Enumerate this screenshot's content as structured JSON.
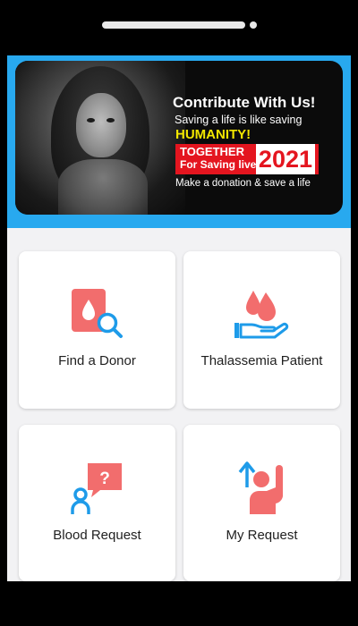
{
  "banner": {
    "title": "Contribute With Us!",
    "subtitle": "Saving a life is like saving",
    "highlight": "HUMANITY!",
    "badge_line1": "TOGETHER",
    "badge_line2": "For Saving lives",
    "badge_year": "2021",
    "tagline": "Make a donation & save a life"
  },
  "cards": [
    {
      "label": "Find a Donor",
      "icon": "blood-bag-search-icon"
    },
    {
      "label": "Thalassemia Patient",
      "icon": "hand-blood-drop-icon"
    },
    {
      "label": "Blood Request",
      "icon": "person-question-icon"
    },
    {
      "label": "My Request",
      "icon": "person-raise-hand-icon"
    }
  ],
  "colors": {
    "accent_red": "#f26d6d",
    "accent_blue": "#1e9be9",
    "banner_bg": "#28a9ef",
    "badge_red": "#e4151f",
    "highlight_yellow": "#f2e600"
  }
}
